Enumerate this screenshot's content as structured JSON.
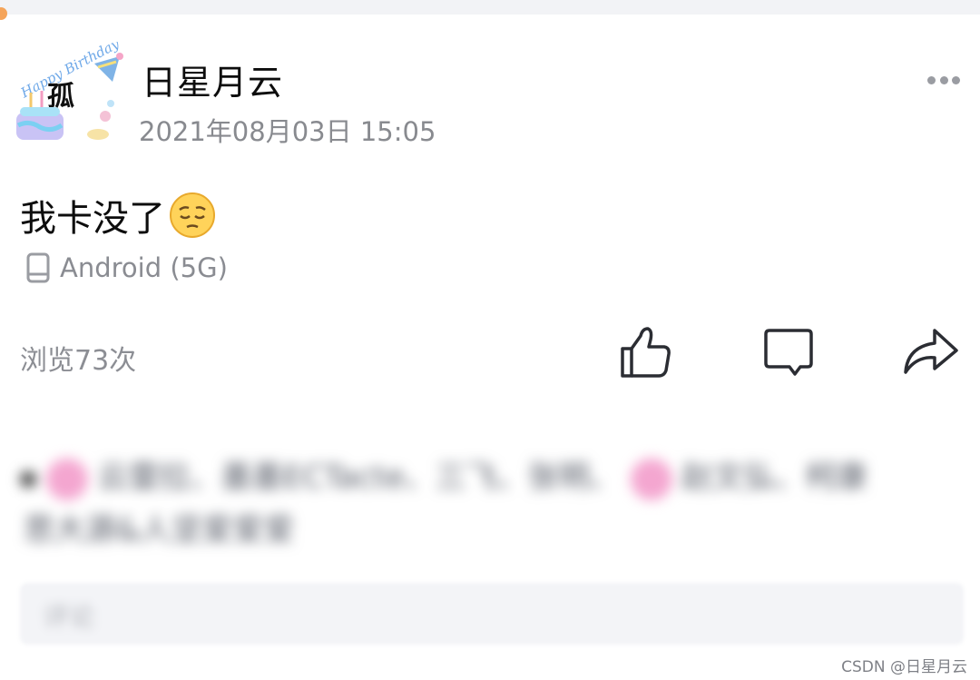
{
  "post": {
    "author": "日星月云",
    "timestamp": "2021年08月03日 15:05",
    "text": "我卡没了",
    "emoji": "pensive-face",
    "device": "Android (5G)",
    "views": "浏览73次"
  },
  "actions": {
    "like": "thumbs-up-icon",
    "comment": "comment-icon",
    "share": "share-icon"
  },
  "likes_blurred": {
    "line1": "云雷拉、墨墨ECTacte、三飞、张明、",
    "line1b": "赵文弘、柯康",
    "line2": "思大源&人坚爱爱爱"
  },
  "comment_input": {
    "placeholder": "评论"
  },
  "watermark": "CSDN @日星月云",
  "colors": {
    "accent_pink": "#f4a6d0",
    "muted_text": "#888a8f",
    "icon_dark": "#2b2d33"
  }
}
